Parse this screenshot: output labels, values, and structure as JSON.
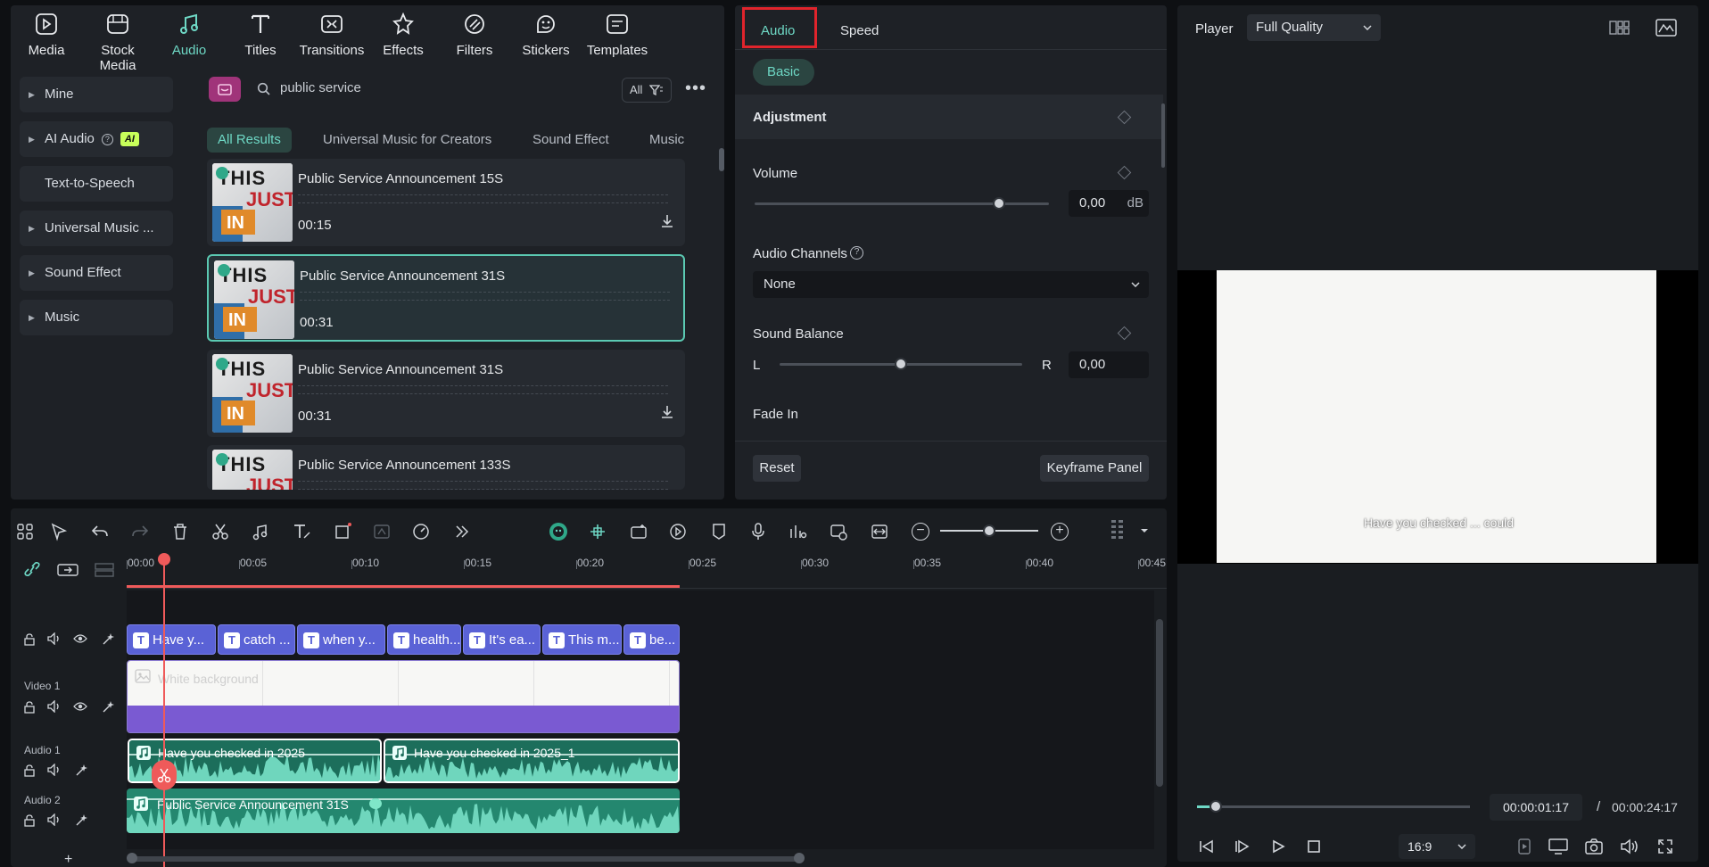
{
  "toolbar": {
    "items": [
      {
        "label": "Media",
        "icon": "media-icon"
      },
      {
        "label": "Stock Media",
        "icon": "stock-media-icon"
      },
      {
        "label": "Audio",
        "icon": "audio-note-icon",
        "active": true
      },
      {
        "label": "Titles",
        "icon": "titles-icon"
      },
      {
        "label": "Transitions",
        "icon": "transitions-icon"
      },
      {
        "label": "Effects",
        "icon": "effects-icon"
      },
      {
        "label": "Filters",
        "icon": "filters-icon"
      },
      {
        "label": "Stickers",
        "icon": "stickers-icon"
      },
      {
        "label": "Templates",
        "icon": "templates-icon"
      }
    ]
  },
  "sidebar": {
    "items": [
      {
        "label": "Mine",
        "expandable": true
      },
      {
        "label": "AI Audio",
        "expandable": true,
        "badge": "AI"
      },
      {
        "label": "Text-to-Speech",
        "expandable": false
      },
      {
        "label": "Universal Music ...",
        "expandable": true
      },
      {
        "label": "Sound Effect",
        "expandable": true
      },
      {
        "label": "Music",
        "expandable": true
      }
    ]
  },
  "search": {
    "value": "public service",
    "filter_label": "All"
  },
  "result_tabs": [
    "All Results",
    "Universal Music for Creators",
    "Sound Effect",
    "Music"
  ],
  "results": [
    {
      "title": "Public Service Announcement 15S",
      "duration": "00:15"
    },
    {
      "title": "Public Service Announcement 31S",
      "duration": "00:31",
      "selected": true
    },
    {
      "title": "Public Service Announcement 31S",
      "duration": "00:31"
    },
    {
      "title": "Public Service Announcement 133S",
      "duration": ""
    }
  ],
  "thumb_text": {
    "line1": "THIS",
    "line2": "JUST",
    "line3": "IN"
  },
  "props": {
    "tabs": [
      "Audio",
      "Speed"
    ],
    "sub_tab": "Basic",
    "section": "Adjustment",
    "volume_label": "Volume",
    "volume_value": "0,00",
    "volume_unit": "dB",
    "volume_level": 0.83,
    "channels_label": "Audio Channels",
    "channels_value": "None",
    "balance_label": "Sound Balance",
    "balance_left": "L",
    "balance_right": "R",
    "balance_value": "0,00",
    "balance_level": 0.5,
    "fade_in_label": "Fade In",
    "reset_label": "Reset",
    "keyframe_label": "Keyframe Panel"
  },
  "player": {
    "label": "Player",
    "quality": "Full Quality",
    "subtitle": "Have you checked ... could",
    "current_time": "00:00:01:17",
    "separator": "/",
    "total_time": "00:00:24:17",
    "progress": 0.07,
    "aspect": "16:9"
  },
  "timeline": {
    "ticks": [
      "00:00",
      "00:05",
      "00:10",
      "00:15",
      "00:20",
      "00:25",
      "00:30",
      "00:35",
      "00:40",
      "00:45"
    ],
    "title_clips": [
      "Have y...",
      "catch ...",
      "when y...",
      "health...",
      "It's ea...",
      "This m...",
      "be..."
    ],
    "video_track_label": "Video 1",
    "video_clip_label": "White background",
    "audio1_label": "Audio 1",
    "audio1_clips": [
      "Have you checked in  2025",
      "Have you checked in  2025_1"
    ],
    "audio2_label": "Audio 2",
    "audio2_clip": "Public Service Announcement 31S",
    "add_track": "+"
  },
  "colors": {
    "accent": "#6ed8c5",
    "title_clip": "#5a62d6",
    "audio_clip": "#2fa889",
    "playhead": "#ef5a5a",
    "highlight_box": "#e0242c"
  }
}
